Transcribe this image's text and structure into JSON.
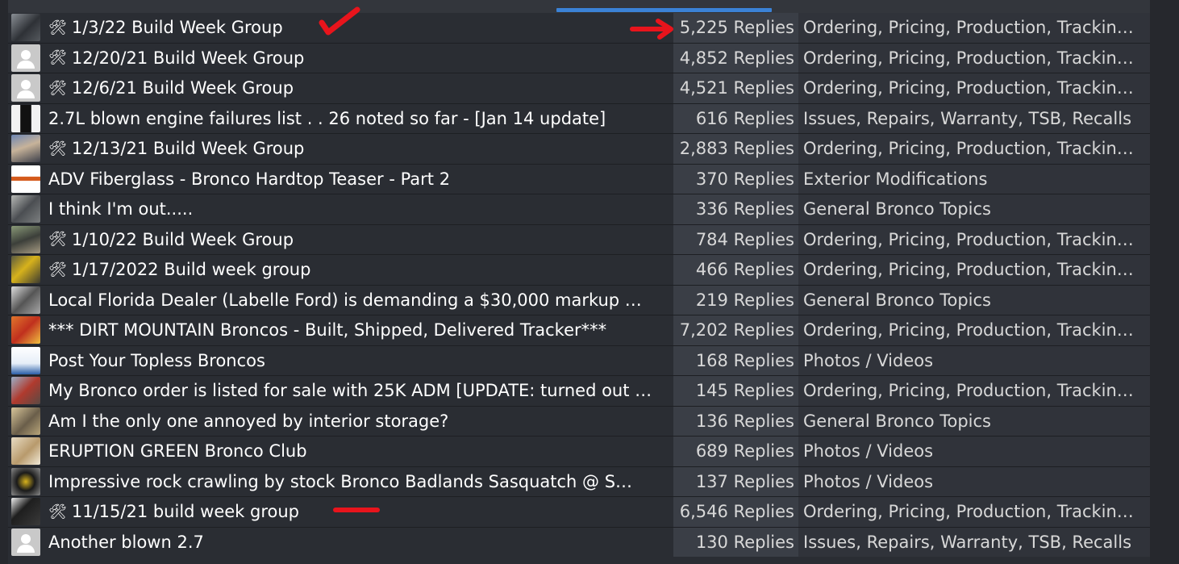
{
  "threads": [
    {
      "title": "1/3/22 Build Week Group",
      "has_tool_icon": true,
      "replies": "5,225 Replies",
      "forum": "Ordering, Pricing, Production, Trackin…",
      "avatar": "photo-dark-suv"
    },
    {
      "title": "12/20/21 Build Week Group",
      "has_tool_icon": true,
      "replies": "4,852 Replies",
      "forum": "Ordering, Pricing, Production, Trackin…",
      "avatar": "default"
    },
    {
      "title": "12/6/21 Build Week Group",
      "has_tool_icon": true,
      "replies": "4,521 Replies",
      "forum": "Ordering, Pricing, Production, Trackin…",
      "avatar": "default"
    },
    {
      "title": "2.7L blown engine failures list . . 26 noted so far - [Jan 14 update]",
      "has_tool_icon": false,
      "replies": "616 Replies",
      "forum": "Issues, Repairs, Warranty, TSB, Recalls",
      "avatar": "photo-boot"
    },
    {
      "title": "12/13/21 Build Week Group",
      "has_tool_icon": true,
      "replies": "2,883 Replies",
      "forum": "Ordering, Pricing, Production, Trackin…",
      "avatar": "photo-person"
    },
    {
      "title": "ADV Fiberglass - Bronco Hardtop Teaser - Part 2",
      "has_tool_icon": false,
      "replies": "370 Replies",
      "forum": "Exterior Modifications",
      "avatar": "logo-adv"
    },
    {
      "title": "I think I'm out.....",
      "has_tool_icon": false,
      "replies": "336 Replies",
      "forum": "General Bronco Topics",
      "avatar": "photo-gray-suv"
    },
    {
      "title": "1/10/22 Build Week Group",
      "has_tool_icon": true,
      "replies": "784 Replies",
      "forum": "Ordering, Pricing, Production, Trackin…",
      "avatar": "photo-rider"
    },
    {
      "title": "1/17/2022 Build week group",
      "has_tool_icon": true,
      "replies": "466 Replies",
      "forum": "Ordering, Pricing, Production, Trackin…",
      "avatar": "photo-yellow-machine"
    },
    {
      "title": "Local Florida Dealer (Labelle Ford) is demanding a $30,000 markup …",
      "has_tool_icon": false,
      "replies": "219 Replies",
      "forum": "General Bronco Topics",
      "avatar": "photo-offroad"
    },
    {
      "title": "*** DIRT MOUNTAIN Broncos - Built, Shipped, Delivered Tracker***",
      "has_tool_icon": false,
      "replies": "7,202 Replies",
      "forum": "Ordering, Pricing, Production, Trackin…",
      "avatar": "logo-dirt-mountain"
    },
    {
      "title": "Post Your Topless Broncos",
      "has_tool_icon": false,
      "replies": "168 Replies",
      "forum": "Photos / Videos",
      "avatar": "logo-bronco"
    },
    {
      "title": "My Bronco order is listed for sale with 25K ADM [UPDATE: turned out …",
      "has_tool_icon": false,
      "replies": "145 Replies",
      "forum": "Ordering, Pricing, Production, Trackin…",
      "avatar": "photo-red-suv"
    },
    {
      "title": "Am I the only one annoyed by interior storage?",
      "has_tool_icon": false,
      "replies": "136 Replies",
      "forum": "General Bronco Topics",
      "avatar": "photo-desert"
    },
    {
      "title": "ERUPTION GREEN Bronco Club",
      "has_tool_icon": false,
      "replies": "689 Replies",
      "forum": "Photos / Videos",
      "avatar": "photo-horse"
    },
    {
      "title": "Impressive rock crawling by stock Bronco Badlands Sasquatch @ S…",
      "has_tool_icon": false,
      "replies": "137 Replies",
      "forum": "Photos / Videos",
      "avatar": "photo-wheel"
    },
    {
      "title": "11/15/21 build week group",
      "has_tool_icon": true,
      "replies": "6,546 Replies",
      "forum": "Ordering, Pricing, Production, Trackin…",
      "avatar": "photo-black-suv"
    },
    {
      "title": "Another blown 2.7",
      "has_tool_icon": false,
      "replies": "130 Replies",
      "forum": "Issues, Repairs, Warranty, TSB, Recalls",
      "avatar": "default"
    }
  ],
  "tool_icon_glyph": "🛠",
  "colors": {
    "accent": "#3b82d6",
    "annotation": "#e8141c"
  }
}
